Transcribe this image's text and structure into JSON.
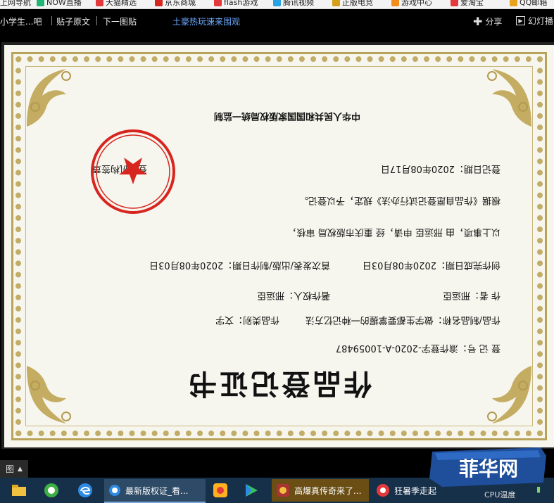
{
  "bookmarks": [
    {
      "label": "上网导航",
      "color": "#2a7de1"
    },
    {
      "label": "NOW直播",
      "color": "#1fb574"
    },
    {
      "label": "天猫精选",
      "color": "#e4393c"
    },
    {
      "label": "京东商城",
      "color": "#d7261d"
    },
    {
      "label": "flash游戏",
      "color": "#e4393c"
    },
    {
      "label": "腾讯视频",
      "color": "#25a3e6"
    },
    {
      "label": "正版电竞",
      "color": "#d4a017"
    },
    {
      "label": "游戏中心",
      "color": "#f28c1b"
    },
    {
      "label": "爱淘宝",
      "color": "#e4393c"
    },
    {
      "label": "QQ邮箱",
      "color": "#e9a21b"
    }
  ],
  "nav": {
    "forum": "小学生...吧",
    "original_post": "贴子原文",
    "next_image": "下一图贴",
    "ad_text": "土豪热玩速来围观",
    "share": "分享",
    "slideshow": "幻灯播"
  },
  "certificate": {
    "title": "作品登记证书",
    "reg_no": "登 记 号：渝作登字-2020-A-10059487",
    "work_name": "作品/制品名称：做学生都要掌握的一种记忆方法",
    "work_type": "作品类别：文字",
    "author": "作        者：邢运臣",
    "owner": "著作权人：邢运臣",
    "completion_date": "创作完成日期：2020年08月03日",
    "publish_date": "首次发表/出版/制作日期：2020年08月03日",
    "review_line": "以上事项，由             邢运臣               申请，经      重庆市版权局            审核，",
    "basis_line": "根据《作品自愿登记试行办法》规定，予以登记。",
    "reg_date": "登记日期：2020年08月17日",
    "issuer": "登记机构签章",
    "footer": "中华人民共和国国家版权局统一监制",
    "seal_text_outer": "重庆市版权局",
    "seal_text_inner": "作品自愿登记专用章"
  },
  "thumb_label": "图",
  "taskbar": {
    "apps": [
      {
        "label": "最新版权证_看..."
      },
      {
        "label": "高爆真传奇来了..."
      },
      {
        "label": "狂暑季走起"
      }
    ],
    "cpu_label": "CPU温度"
  },
  "watermark": "菲华网",
  "colors": {
    "border_gold": "#b9a35a",
    "seal_red": "#d7251f",
    "taskbar_bg": "#17304a",
    "link_blue": "#6aa9ff"
  }
}
